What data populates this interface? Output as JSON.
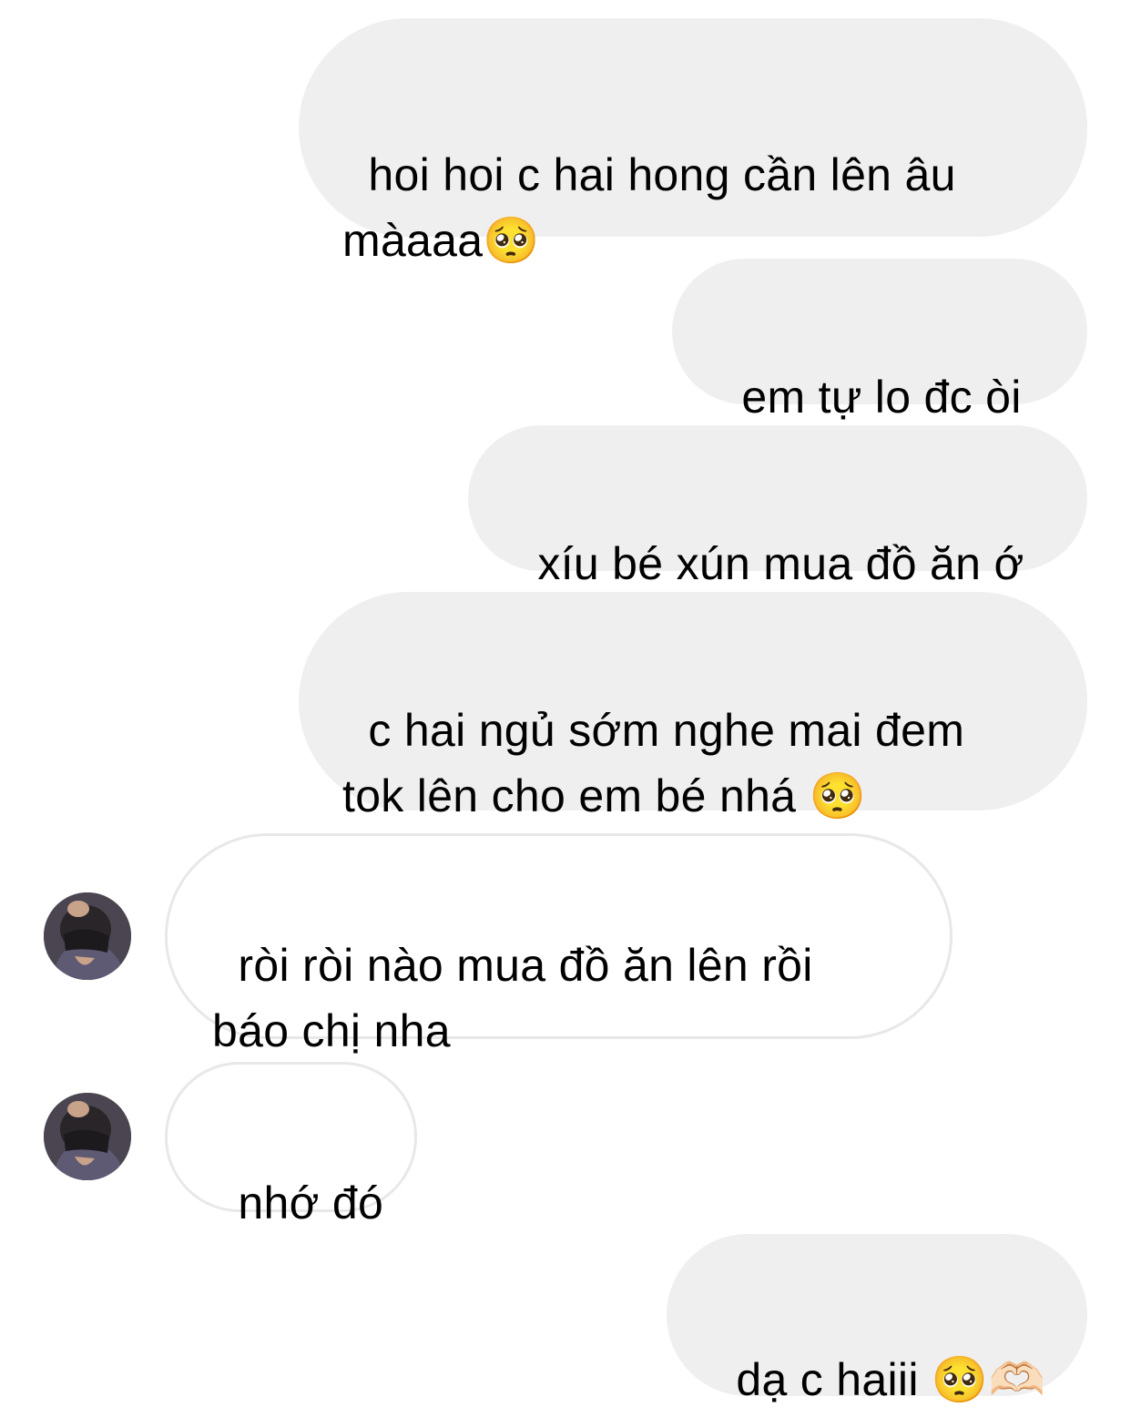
{
  "conversation": {
    "messages": [
      {
        "sender": "me",
        "text": "hoi hoi c hai hong cần lên âu\nmàaaa🥺"
      },
      {
        "sender": "me",
        "text": "em tự lo đc òi"
      },
      {
        "sender": "me",
        "text": "xíu bé xún mua đồ ăn ớ"
      },
      {
        "sender": "me",
        "text": "c hai ngủ sớm nghe mai đem\ntok lên cho em bé nhá 🥺"
      },
      {
        "sender": "other",
        "text": "ròi ròi nào mua đồ ăn lên rồi\nbáo chị nha"
      },
      {
        "sender": "other",
        "text": "nhớ đó"
      },
      {
        "sender": "me",
        "text": "dạ c haiii 🥺🫶🏻"
      }
    ]
  },
  "colors": {
    "sent_bubble": "#efefef",
    "received_bubble": "#ffffff",
    "received_border": "#e8e8e8",
    "text": "#000000"
  },
  "icons": {
    "avatar": "contact-avatar-photo"
  }
}
